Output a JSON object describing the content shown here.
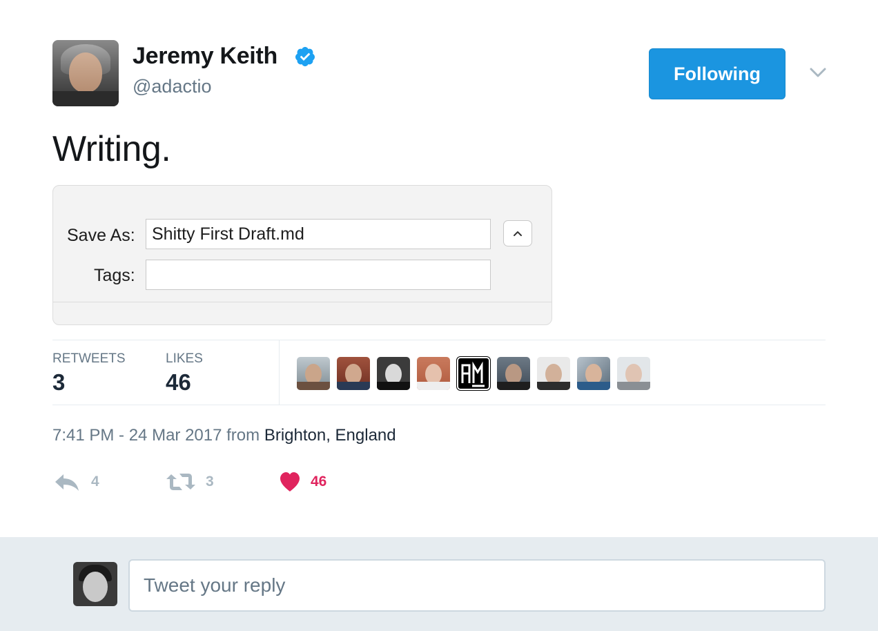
{
  "author": {
    "name": "Jeremy Keith",
    "handle": "@adactio",
    "verified": true
  },
  "header": {
    "follow_button_label": "Following",
    "more_icon": "chevron-down-icon"
  },
  "tweet": {
    "text": "Writing."
  },
  "media": {
    "save_as_label": "Save As:",
    "save_as_value": "Shitty First Draft.md",
    "tags_label": "Tags:",
    "tags_value": "",
    "disclosure_icon": "chevron-up-icon"
  },
  "stats": {
    "retweets_label": "RETWEETS",
    "retweets_value": "3",
    "likes_label": "LIKES",
    "likes_value": "46",
    "likers": [
      {
        "name": "liker-1"
      },
      {
        "name": "liker-2"
      },
      {
        "name": "liker-3"
      },
      {
        "name": "liker-4"
      },
      {
        "name": "liker-5"
      },
      {
        "name": "liker-6"
      },
      {
        "name": "liker-7"
      },
      {
        "name": "liker-8"
      },
      {
        "name": "liker-9"
      }
    ]
  },
  "meta": {
    "timestamp": "7:41 PM - 24 Mar 2017",
    "from_word": "from",
    "location": "Brighton, England"
  },
  "actions": {
    "reply_count": "4",
    "retweet_count": "3",
    "like_count": "46"
  },
  "reply": {
    "placeholder": "Tweet your reply"
  },
  "colors": {
    "accent": "#1b95e0",
    "like": "#e0245e",
    "muted": "#657786",
    "dark": "#1c2938"
  }
}
